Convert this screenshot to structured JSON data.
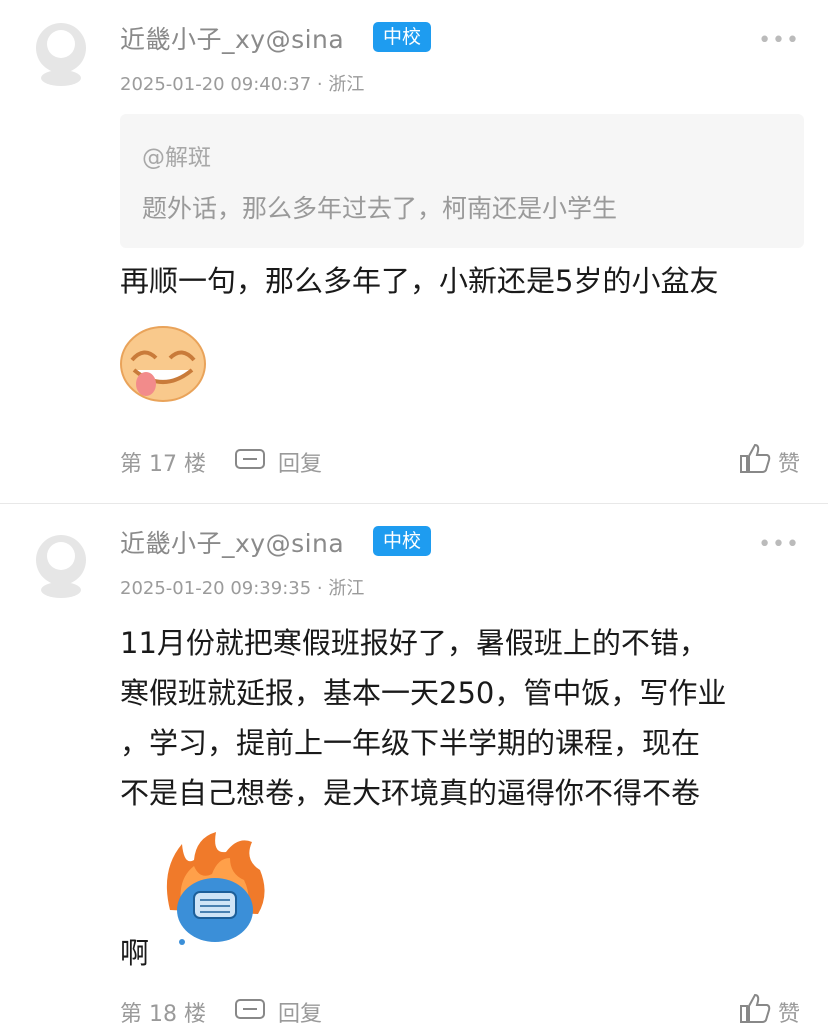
{
  "comments": [
    {
      "username": "近畿小子_xy@sina",
      "badge": "中校",
      "more": "•••",
      "meta": "2025-01-20 09:40:37 · 浙江",
      "quote": {
        "user": "@解斑",
        "text": "题外话，那么多年过去了，柯南还是小学生"
      },
      "body_lines": [
        "再顺一句，那么多年了，小新还是5岁的小盆友"
      ],
      "sticker": "laughing-face-sticker",
      "trailing_text": "",
      "floor": "第 17 楼",
      "reply_label": "回复",
      "like_label": "赞"
    },
    {
      "username": "近畿小子_xy@sina",
      "badge": "中校",
      "more": "•••",
      "meta": "2025-01-20 09:39:35 · 浙江",
      "body_lines": [
        "11月份就把寒假班报好了，暑假班上的不错，",
        "寒假班就延报，基本一天250，管中饭，写作业",
        "，学习，提前上一年级下半学期的课程，现在",
        "不是自己想卷，是大环境真的逼得你不得不卷"
      ],
      "sticker": "angry-fire-face-sticker",
      "trailing_text": "啊",
      "floor": "第 18 楼",
      "reply_label": "回复",
      "like_label": "赞"
    }
  ],
  "colors": {
    "badge": "#1e9cf0",
    "meta": "#9b9b9b",
    "quote_bg": "#f6f6f6"
  }
}
